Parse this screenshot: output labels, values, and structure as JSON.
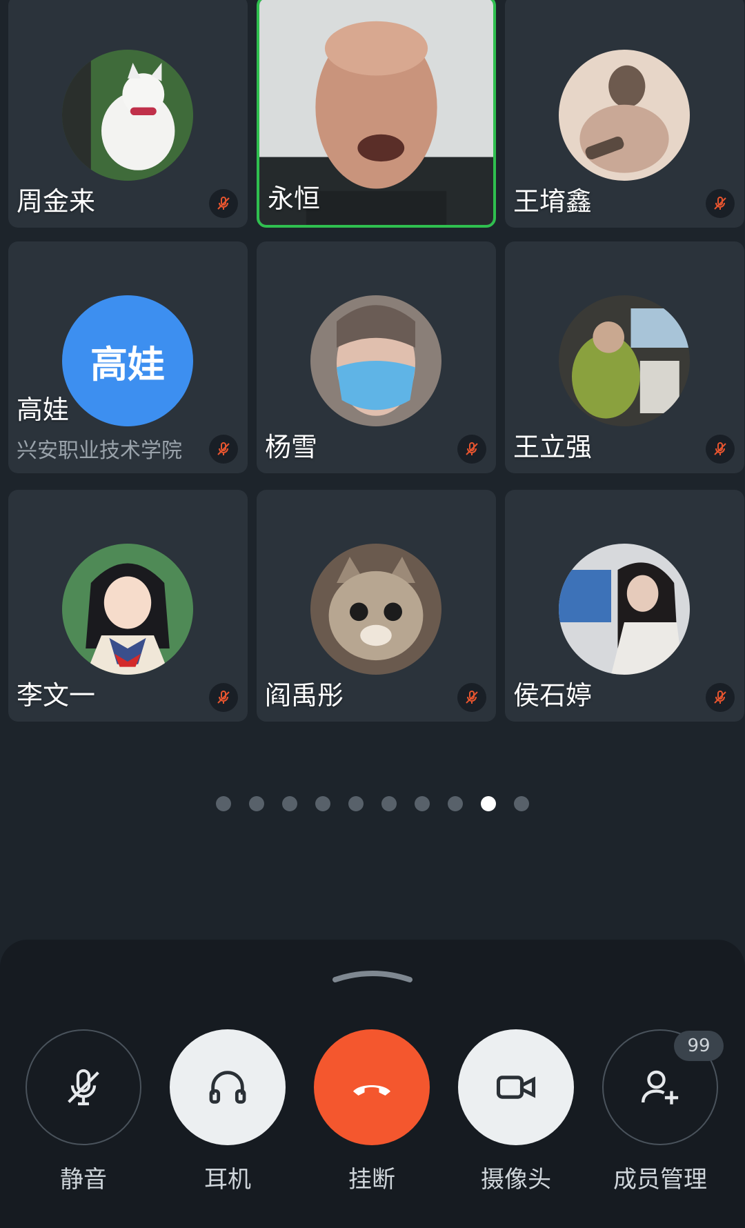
{
  "participants": [
    {
      "name": "周金来",
      "muted": true,
      "avatar": "cat-avatar"
    },
    {
      "name": "永恒",
      "muted": false,
      "speaking": true,
      "avatar": "video-feed"
    },
    {
      "name": "王堉鑫",
      "muted": true,
      "avatar": "sketch-avatar"
    },
    {
      "name": "高娃",
      "org": "兴安职业技术学院",
      "avatar_text": "高娃",
      "muted": true
    },
    {
      "name": "杨雪",
      "muted": true,
      "avatar": "masked-girl-avatar"
    },
    {
      "name": "王立强",
      "muted": true,
      "avatar": "car-photo-avatar"
    },
    {
      "name": "李文一",
      "muted": true,
      "avatar": "anime-girl-avatar"
    },
    {
      "name": "阎禹彤",
      "muted": true,
      "avatar": "kitten-avatar"
    },
    {
      "name": "侯石婷",
      "muted": true,
      "avatar": "woman-photo-avatar"
    }
  ],
  "pagination": {
    "total": 10,
    "current": 9
  },
  "controls": {
    "mute": "静音",
    "earphone": "耳机",
    "hangup": "挂断",
    "camera": "摄像头",
    "members": "成员管理",
    "members_badge": "99"
  },
  "colors": {
    "active_border": "#2fbf4f",
    "hangup": "#f4572e",
    "text_avatar": "#3d8ff0",
    "mic_off": "#e8552f"
  }
}
